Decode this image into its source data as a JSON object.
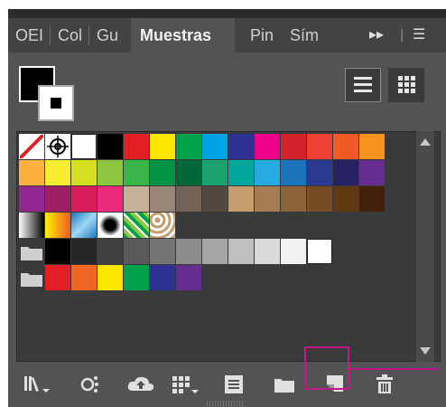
{
  "tabs": [
    {
      "label": "OEI"
    },
    {
      "label": "Col"
    },
    {
      "label": "Gu"
    },
    {
      "label": "Muestras"
    },
    {
      "label": "Pin"
    },
    {
      "label": "Sím"
    }
  ],
  "controls": {
    "more": "▸▸",
    "menu": "☰"
  },
  "icons": {
    "list_view": "list-view-icon",
    "grid_view": "grid-view-icon",
    "libraries": "swatch-libraries-menu-icon",
    "show_kinds": "show-swatch-kinds-icon",
    "cloud": "cc-libraries-icon",
    "swatch_options_menu": "swatch-options-menu-icon",
    "swatch_options": "swatch-options-icon",
    "new_group": "new-color-group-icon",
    "new_swatch": "new-swatch-icon",
    "delete": "delete-swatch-icon"
  },
  "colors": {
    "accent": "#c2188c",
    "panel": "#535353",
    "tabbar": "#434343"
  },
  "swatch_rows": [
    [
      "none",
      "registration",
      "#ffffff",
      "#000000",
      "#e41e26",
      "#ffe600",
      "#00a14b",
      "#00a4e4",
      "#2e3192",
      "#ec008c",
      "#d2232a",
      "#ef4136",
      "#f15a24",
      "#f7941d"
    ],
    [
      "#fbb040",
      "#f9ed32",
      "#d7df23",
      "#8dc63f",
      "#39b54a",
      "#009444",
      "#006838",
      "#1ba26e",
      "#00a79d",
      "#27aae1",
      "#1c75bc",
      "#2b3990",
      "#262262",
      "#662d91"
    ],
    [
      "#92278f",
      "#9e1f63",
      "#da1c5c",
      "#ee2a7b",
      "#c7b299",
      "#998675",
      "#736357",
      "#534741",
      "#c69c6d",
      "#a67c52",
      "#8c6239",
      "#754c24",
      "#603813",
      "#42210b"
    ],
    [
      "gradient-black",
      "gradient-orange",
      "gradient-blue",
      "pattern-dots",
      "pattern-leaves",
      "pattern-floral"
    ],
    [
      "folder",
      "#000000",
      "#262626",
      "#404040",
      "#595959",
      "#737373",
      "#8c8c8c",
      "#a6a6a6",
      "#bfbfbf",
      "#d9d9d9",
      "#f2f2f2",
      "#ffffff"
    ],
    [
      "folder",
      "#e41e26",
      "#f26522",
      "#ffe600",
      "#00a14b",
      "#2e3192",
      "#662d91"
    ]
  ]
}
